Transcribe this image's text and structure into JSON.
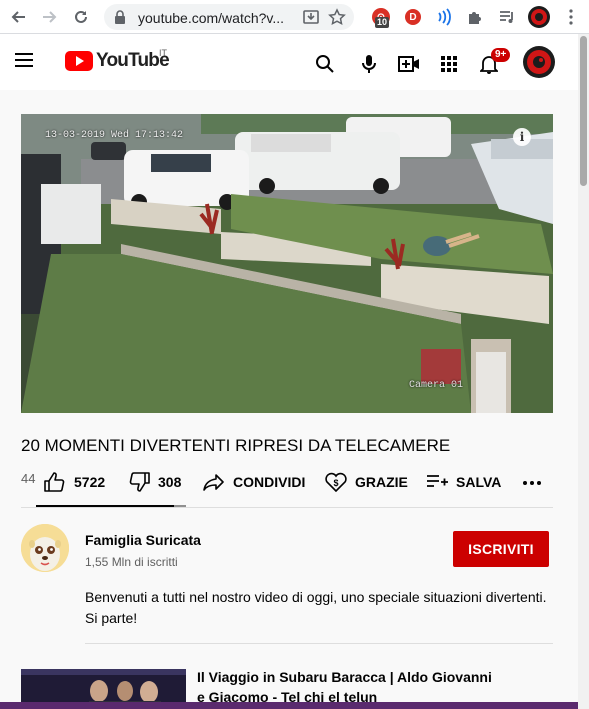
{
  "browser": {
    "url": "youtube.com/watch?v...",
    "extension_badge": "10",
    "extension2_letter": "D"
  },
  "masthead": {
    "logo_text": "YouTube",
    "country_code": "IT",
    "notification_count": "9+"
  },
  "video": {
    "timestamp_overlay": "13-03-2019 Wed 17:13:42",
    "camera_label": "Camera 01",
    "info_icon": "i"
  },
  "watch": {
    "title": "20 MOMENTI DIVERTENTI RIPRESI DA TELECAMERE",
    "views_partial": "44",
    "like_count": "5722",
    "like_ratio": 0.92,
    "dislike_count": "308",
    "share_label": "CONDIVIDI",
    "thanks_label": "GRAZIE",
    "save_label": "SALVA"
  },
  "channel": {
    "name": "Famiglia Suricata",
    "subscribers": "1,55 Mln di iscritti",
    "subscribe_label": "ISCRIVITI",
    "description": "Benvenuti a tutti nel nostro video di oggi, uno speciale situazioni divertenti. Si parte!"
  },
  "recommendation": {
    "title": "Il Viaggio in Subaru Baracca | Aldo Giovanni e Giacomo - Tel chi el telun"
  },
  "colors": {
    "brand_red": "#ff0000",
    "subscribe_red": "#cc0000"
  }
}
